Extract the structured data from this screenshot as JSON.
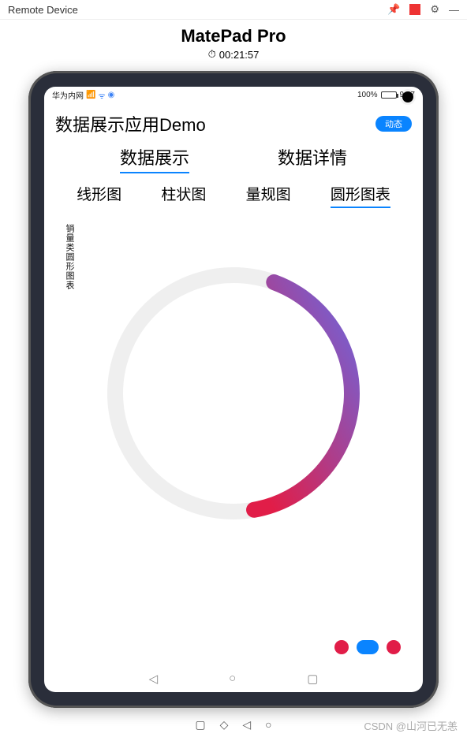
{
  "window": {
    "title": "Remote Device"
  },
  "header": {
    "device_name": "MatePad Pro",
    "timer": "00:21:57"
  },
  "statusbar": {
    "carrier": "华为内网",
    "battery_pct": "100%",
    "time": "9:47"
  },
  "app": {
    "title": "数据展示应用Demo",
    "pill_label": "动态",
    "main_tabs": [
      "数据展示",
      "数据详情"
    ],
    "main_active": 0,
    "sub_tabs": [
      "线形图",
      "柱状图",
      "量规图",
      "圆形图表"
    ],
    "sub_active": 3,
    "chart_label": "销量类圆形图表"
  },
  "chart_data": {
    "type": "pie",
    "title": "销量类圆形图表",
    "arc_start_deg": 20,
    "arc_end_deg": 170,
    "arc_percent": 42,
    "track_color": "#efefef",
    "gradient_from": "#6b67e0",
    "gradient_to": "#e11d48"
  },
  "footer_nav": {
    "back": "◁",
    "home": "○",
    "recent": "▢"
  },
  "host_toolbar": [
    "▢",
    "◇",
    "◁",
    "○"
  ],
  "watermark": "CSDN @山河已无恙"
}
